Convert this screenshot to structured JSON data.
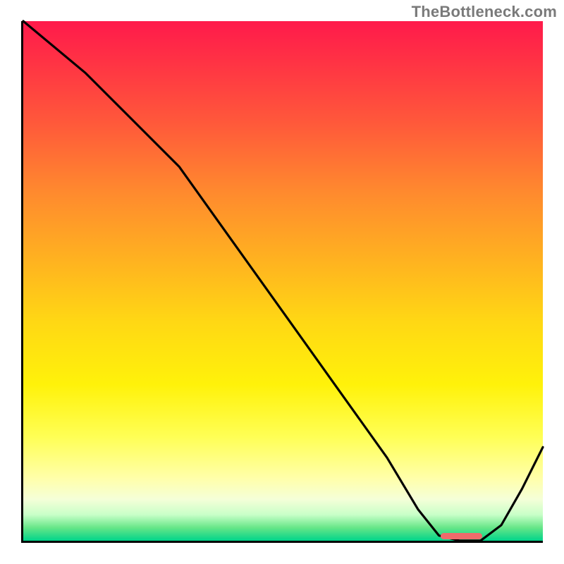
{
  "attribution": "TheBottleneck.com",
  "chart_data": {
    "type": "line",
    "title": "",
    "xlabel": "",
    "ylabel": "",
    "xlim": [
      0,
      100
    ],
    "ylim": [
      0,
      100
    ],
    "series": [
      {
        "name": "bottleneck-curve",
        "x": [
          0,
          12,
          22,
          30,
          40,
          50,
          60,
          70,
          76,
          80,
          84,
          88,
          92,
          96,
          100
        ],
        "values": [
          100,
          90,
          80,
          72,
          58,
          44,
          30,
          16,
          6,
          1,
          0,
          0,
          3,
          10,
          18
        ]
      }
    ],
    "highlight_zone": {
      "x_start": 80,
      "x_end": 88,
      "color": "#ef6b6b"
    },
    "background_gradient": {
      "stops": [
        {
          "pos": 0.0,
          "color": "#ff1a4b"
        },
        {
          "pos": 0.5,
          "color": "#ffd814"
        },
        {
          "pos": 0.9,
          "color": "#ffffaa"
        },
        {
          "pos": 1.0,
          "color": "#00d48a"
        }
      ]
    },
    "legend": []
  }
}
